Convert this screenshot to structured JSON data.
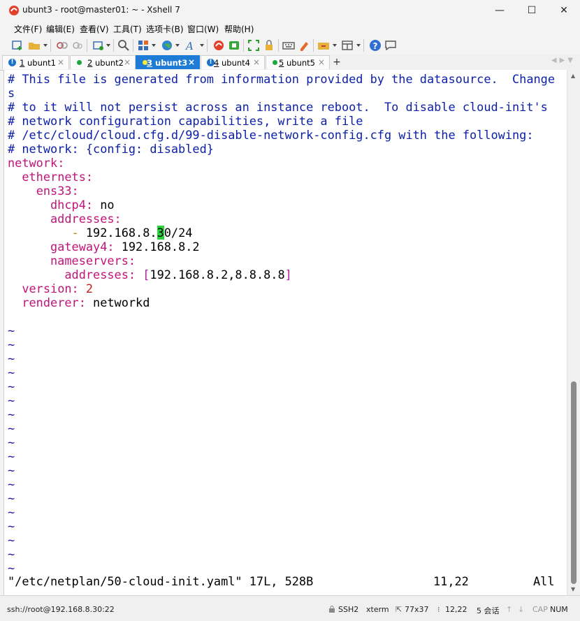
{
  "window": {
    "title": "ubunt3 - root@master01: ~ - Xshell 7",
    "minimize": "—",
    "maximize": "☐",
    "close": "✕"
  },
  "menu": [
    "文件(F)",
    "编辑(E)",
    "查看(V)",
    "工具(T)",
    "选项卡(B)",
    "窗口(W)",
    "帮助(H)"
  ],
  "tabs": [
    {
      "num": "1",
      "name": " ubunt1",
      "active": false,
      "indicator": "info"
    },
    {
      "num": "2",
      "name": " ubunt2",
      "active": false,
      "indicator": "dot"
    },
    {
      "num": "3",
      "name": " ubunt3",
      "active": true,
      "indicator": "dot"
    },
    {
      "num": "4",
      "name": " ubunt4",
      "active": false,
      "indicator": "info"
    },
    {
      "num": "5",
      "name": " ubunt5",
      "active": false,
      "indicator": "dot"
    }
  ],
  "tab_add": "+",
  "tab_close": "×",
  "terminal": {
    "comment_lines": [
      "# This file is generated from information provided by the datasource.  Change",
      "s",
      "# to it will not persist across an instance reboot.  To disable cloud-init's",
      "# network configuration capabilities, write a file",
      "# /etc/cloud/cloud.cfg.d/99-disable-network-config.cfg with the following:",
      "# network: {config: disabled}"
    ],
    "yaml": {
      "network": "network",
      "ethernets": "ethernets",
      "iface": "ens33",
      "dhcp4_key": "dhcp4",
      "dhcp4_val": "no",
      "addresses_key": "addresses",
      "dash": "-",
      "addr_before": "192.168.8.",
      "addr_cursor": "3",
      "addr_after": "0/24",
      "gateway_key": "gateway4",
      "gateway_val": "192.168.8.2",
      "nameservers_key": "nameservers",
      "ns_addresses_key": "addresses",
      "ns_open": "[",
      "ns_val": "192.168.8.2,8.8.8.8",
      "ns_close": "]",
      "version_key": "version",
      "version_val": "2",
      "renderer_key": "renderer",
      "renderer_val": "networkd",
      "colon": ":"
    },
    "tilde": "~",
    "tilde_count": 18,
    "status_file": "\"/etc/netplan/50-cloud-init.yaml\" 17L, 528B",
    "status_pos": "11,22",
    "status_all": "All"
  },
  "statusbar": {
    "connection": "ssh://root@192.168.8.30:22",
    "protocol": "SSH2",
    "term": "xterm",
    "size": "77x37",
    "cursor": "12,22",
    "sessions": "5 会话",
    "caps": "CAP",
    "num": "NUM"
  },
  "colors": {
    "active_tab": "#1e7cd6",
    "comment": "#0b1fa8",
    "key": "#c0157a",
    "cursor": "#2bd33a"
  }
}
